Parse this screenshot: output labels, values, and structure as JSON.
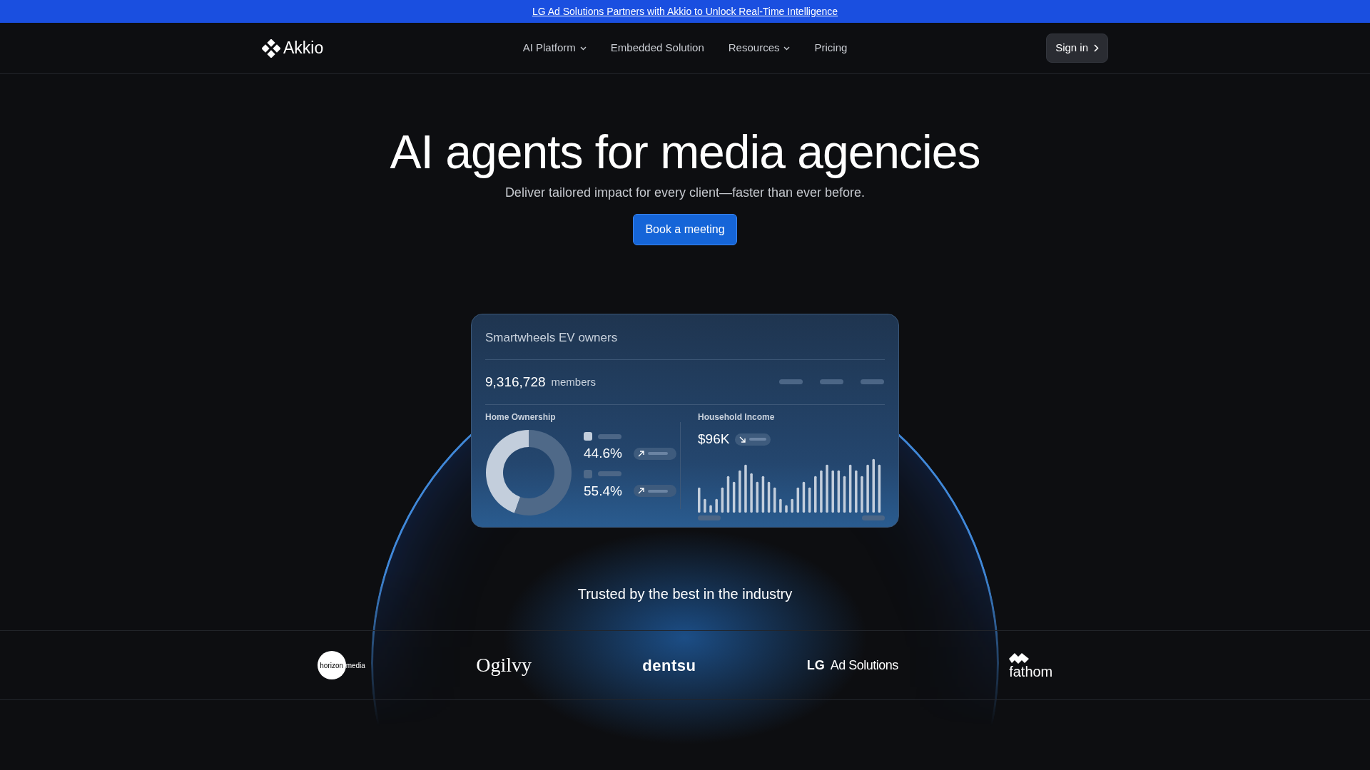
{
  "announcement": {
    "text": "LG Ad Solutions Partners with Akkio to Unlock Real-Time Intelligence"
  },
  "navbar": {
    "brand": "Akkio",
    "links": [
      {
        "label": "AI Platform",
        "dropdown": true
      },
      {
        "label": "Embedded Solution",
        "dropdown": false
      },
      {
        "label": "Resources",
        "dropdown": true
      },
      {
        "label": "Pricing",
        "dropdown": false
      }
    ],
    "sign_in": "Sign in"
  },
  "hero": {
    "title": "AI agents for media agencies",
    "subtitle": "Deliver tailored impact for every client—faster than ever before.",
    "cta": "Book a meeting"
  },
  "card": {
    "title": "Smartwheels EV owners",
    "count": "9,316,728",
    "count_label": "members",
    "home_ownership": {
      "title": "Home Ownership",
      "chart_data": {
        "type": "donut",
        "values": [
          44.6,
          55.4
        ]
      },
      "legend": [
        {
          "value": "44.6%",
          "color": "#c3cedc"
        },
        {
          "value": "55.4%",
          "color": "#4f6988"
        }
      ]
    },
    "household_income": {
      "title": "Household Income",
      "value": "$96K"
    }
  },
  "trusted": "Trusted by the best in the industry",
  "logos": [
    {
      "kind": "horizon",
      "text": "horizon",
      "text_2": "media"
    },
    {
      "kind": "serif",
      "text": "Ogilvy"
    },
    {
      "kind": "bold",
      "text": "dentsu"
    },
    {
      "kind": "lg",
      "text": "LG",
      "text_2": "Ad Solutions"
    },
    {
      "kind": "fathom",
      "text": "fathom"
    }
  ]
}
